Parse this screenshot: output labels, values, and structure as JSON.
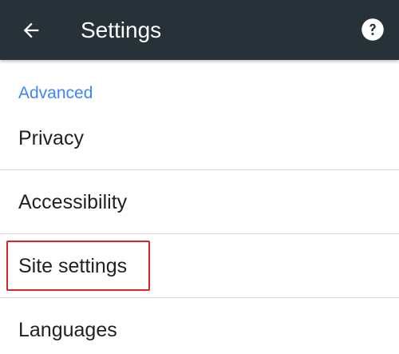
{
  "appbar": {
    "title": "Settings",
    "back_icon": "arrow-left-icon",
    "help_icon": "help-circle-icon",
    "background_color": "#263238"
  },
  "section": {
    "header": "Advanced",
    "header_color": "#4285f4"
  },
  "items": [
    {
      "label": "Privacy"
    },
    {
      "label": "Accessibility"
    },
    {
      "label": "Site settings"
    },
    {
      "label": "Languages"
    }
  ],
  "highlight": {
    "target": "Site settings",
    "color": "#d9262b"
  }
}
